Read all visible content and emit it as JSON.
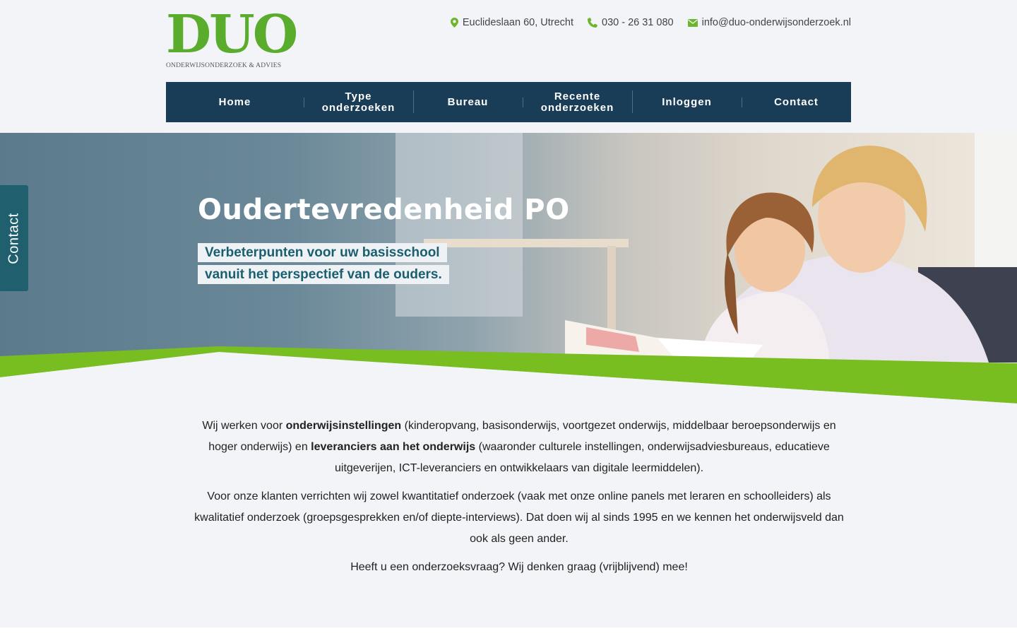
{
  "brand": {
    "logo_text": "DUO",
    "logo_tagline": "ONDERWIJSONDERZOEK & ADVIES",
    "accent_green": "#5aac2c",
    "nav_blue": "#1a3d57",
    "band_green": "#78be20"
  },
  "topbar": {
    "address": "Euclideslaan 60, Utrecht",
    "address_icon": "map-pin-icon",
    "phone": "030 - 26 31 080",
    "phone_icon": "phone-icon",
    "email": "info@duo-onderwijsonderzoek.nl",
    "email_icon": "envelope-icon"
  },
  "nav": {
    "items": [
      {
        "line1": "Home",
        "line2": ""
      },
      {
        "line1": "Type",
        "line2": "onderzoeken"
      },
      {
        "line1": "Bureau",
        "line2": ""
      },
      {
        "line1": "Recente",
        "line2": "onderzoeken"
      },
      {
        "line1": "Inloggen",
        "line2": ""
      },
      {
        "line1": "Contact",
        "line2": ""
      }
    ]
  },
  "hero": {
    "title": "Oudertevredenheid PO",
    "subtitle_line1": "Verbeterpunten voor uw basisschool",
    "subtitle_line2": "vanuit het perspectief van de ouders."
  },
  "contact_tab": {
    "label": "Contact"
  },
  "intro": {
    "p1": {
      "t1": "Wij werken voor ",
      "b1": "onderwijsinstellingen",
      "t2": " (kinderopvang, basisonderwijs, voortgezet onderwijs, middelbaar beroepsonderwijs en hoger onderwijs) en ",
      "b2": "leveranciers aan het onderwijs",
      "t3": " (waaronder culturele instellingen, onderwijsadviesbureaus, educatieve uitgeverijen, ICT-leveranciers en ontwikkelaars van digitale leermiddelen)."
    },
    "p2": "Voor onze klanten verrichten wij zowel kwantitatief onderzoek (vaak met onze online panels met leraren en schoolleiders) als kwalitatief onderzoek (groepsgesprekken en/of diepte-interviews). Dat doen wij al sinds 1995 en we kennen het onderwijsveld dan ook als geen ander.",
    "p3": "Heeft u een onderzoeksvraag? Wij denken graag (vrijblijvend) mee!"
  }
}
